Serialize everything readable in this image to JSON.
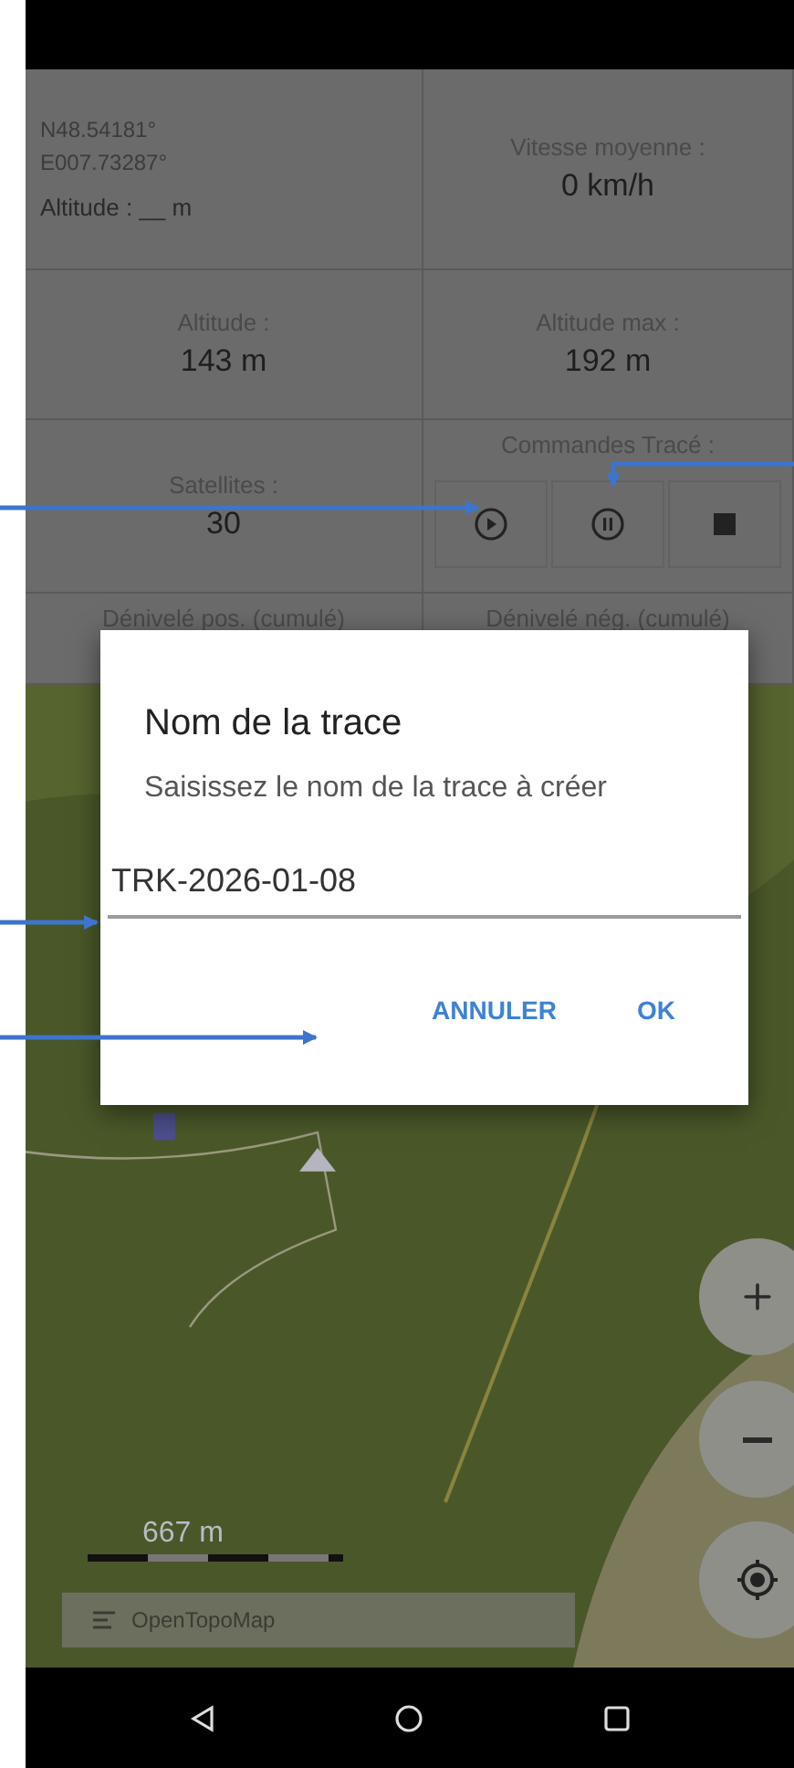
{
  "info_grid": {
    "position": {
      "latitude": "N48.54181°",
      "longitude": "E007.73287°",
      "altitude": "Altitude : __ m"
    },
    "average_speed": {
      "label": "Vitesse moyenne :",
      "value": "0 km/h"
    },
    "altitude": {
      "label": "Altitude :",
      "value": "143 m"
    },
    "max_altitude": {
      "label": "Altitude max :",
      "value": "192 m"
    },
    "satellites": {
      "label": "Satellites :",
      "value": "30"
    },
    "track_controls": {
      "label": "Commandes Tracé :",
      "buttons": [
        {
          "kind": "play"
        },
        {
          "kind": "pause"
        },
        {
          "kind": "stop"
        }
      ]
    },
    "positive_elevation": {
      "label": "Dénivelé pos. (cumulé)"
    },
    "negative_elevation": {
      "label": "Dénivelé nég. (cumulé)"
    }
  },
  "dialog": {
    "title": "Nom de la trace",
    "message": "Saisissez le nom de la trace à créer",
    "value": "TRK-2026-01-08",
    "buttons": [
      "ANNULER",
      "OK"
    ]
  },
  "map": {
    "scale": "667 m",
    "attribution": "OpenTopoMap"
  },
  "nav_bar": [
    {
      "kind": "back"
    },
    {
      "kind": "home"
    },
    {
      "kind": "recents"
    }
  ]
}
